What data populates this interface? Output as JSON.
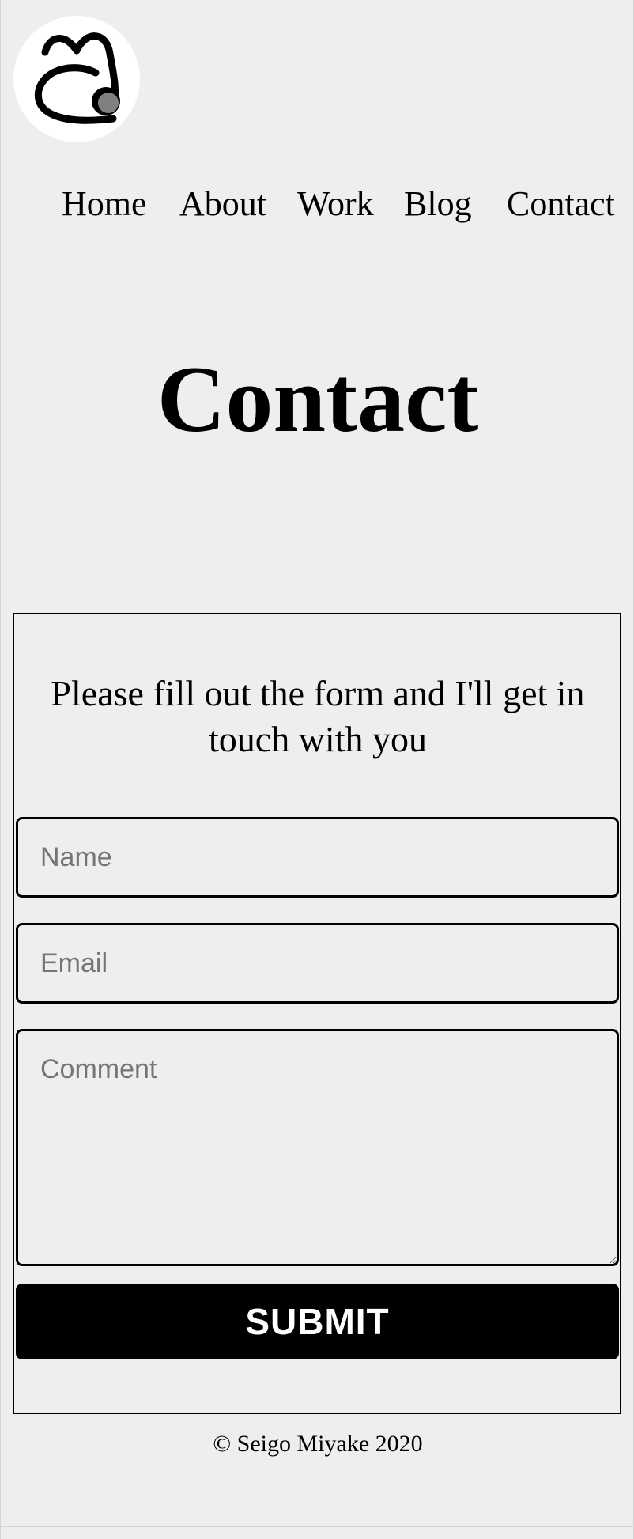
{
  "header": {
    "logo_icon": "stylized-m-logo-icon"
  },
  "nav": {
    "home": "Home",
    "about": "About",
    "work": "Work",
    "blog": "Blog",
    "contact": "Contact"
  },
  "main": {
    "title": "Contact",
    "intro": "Please fill out the form and I'll get in touch with you",
    "form": {
      "name_placeholder": "Name",
      "name_value": "",
      "email_placeholder": "Email",
      "email_value": "",
      "comment_placeholder": "Comment",
      "comment_value": "",
      "submit_label": "SUBMIT"
    }
  },
  "footer": {
    "copyright": "© Seigo Miyake 2020"
  },
  "colors": {
    "background": "#eeeeee",
    "text": "#000000",
    "button": "#000000",
    "button_text": "#ffffff",
    "placeholder": "#757575"
  }
}
